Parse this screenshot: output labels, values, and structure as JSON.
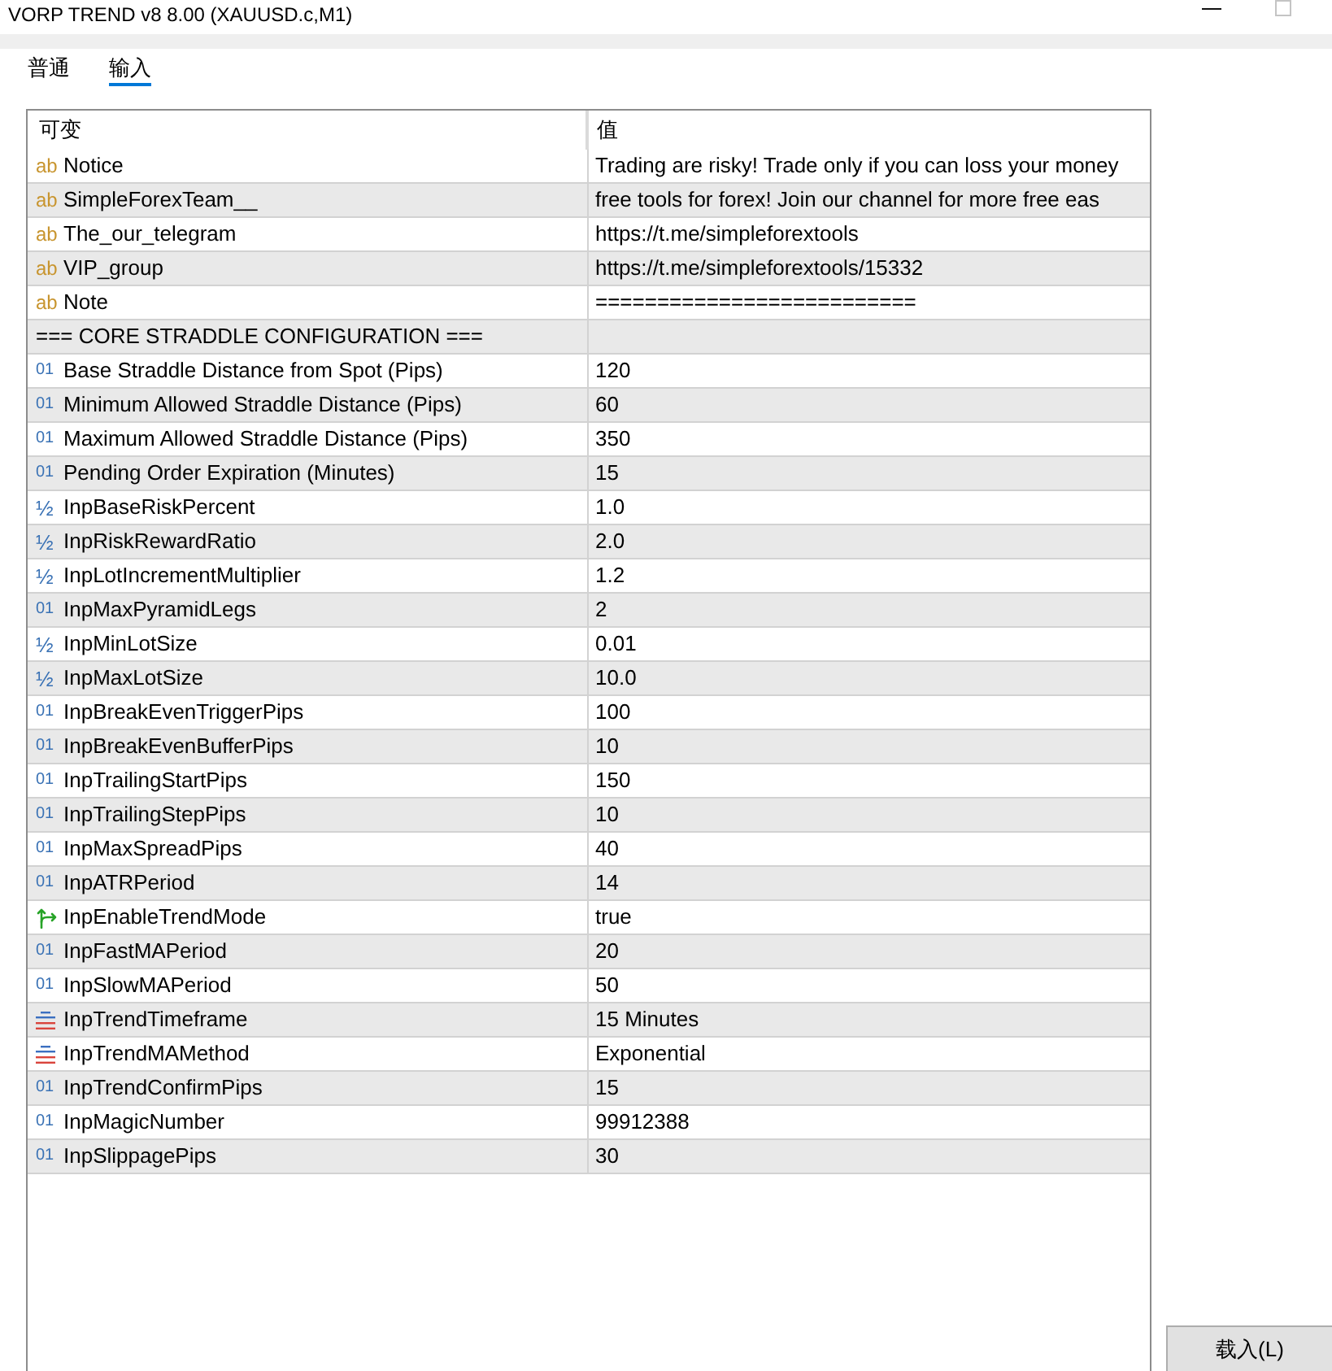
{
  "window": {
    "title": "VORP TREND v8 8.00 (XAUUSD.c,M1)"
  },
  "tabs": [
    {
      "label": "普通",
      "selected": false
    },
    {
      "label": "输入",
      "selected": true
    }
  ],
  "table": {
    "columns": [
      "可变",
      "值"
    ],
    "rows": [
      {
        "kind": "string",
        "type_icon": "ab",
        "name": "Notice",
        "value": "Trading are risky! Trade only if you can loss your money"
      },
      {
        "kind": "string",
        "type_icon": "ab",
        "name": "SimpleForexTeam__",
        "value": "free tools for forex! Join our channel for more free eas"
      },
      {
        "kind": "string",
        "type_icon": "ab",
        "name": "The_our_telegram",
        "value": "https://t.me/simpleforextools"
      },
      {
        "kind": "string",
        "type_icon": "ab",
        "name": "VIP_group",
        "value": "https://t.me/simpleforextools/15332"
      },
      {
        "kind": "string",
        "type_icon": "ab",
        "name": "Note",
        "value": "=========================="
      },
      {
        "kind": "group",
        "name": "=== CORE STRADDLE CONFIGURATION ==="
      },
      {
        "kind": "integer",
        "type_icon": "01",
        "name": "Base Straddle Distance from Spot (Pips)",
        "value": "120"
      },
      {
        "kind": "integer",
        "type_icon": "01",
        "name": "Minimum Allowed Straddle Distance (Pips)",
        "value": "60"
      },
      {
        "kind": "integer",
        "type_icon": "01",
        "name": "Maximum Allowed Straddle Distance (Pips)",
        "value": "350"
      },
      {
        "kind": "integer",
        "type_icon": "01",
        "name": "Pending Order Expiration (Minutes)",
        "value": "15"
      },
      {
        "kind": "double",
        "type_icon": "½",
        "name": "InpBaseRiskPercent",
        "value": "1.0"
      },
      {
        "kind": "double",
        "type_icon": "½",
        "name": "InpRiskRewardRatio",
        "value": "2.0"
      },
      {
        "kind": "double",
        "type_icon": "½",
        "name": "InpLotIncrementMultiplier",
        "value": "1.2"
      },
      {
        "kind": "integer",
        "type_icon": "01",
        "name": "InpMaxPyramidLegs",
        "value": "2"
      },
      {
        "kind": "double",
        "type_icon": "½",
        "name": "InpMinLotSize",
        "value": "0.01"
      },
      {
        "kind": "double",
        "type_icon": "½",
        "name": "InpMaxLotSize",
        "value": "10.0"
      },
      {
        "kind": "integer",
        "type_icon": "01",
        "name": "InpBreakEvenTriggerPips",
        "value": "100"
      },
      {
        "kind": "integer",
        "type_icon": "01",
        "name": "InpBreakEvenBufferPips",
        "value": "10"
      },
      {
        "kind": "integer",
        "type_icon": "01",
        "name": "InpTrailingStartPips",
        "value": "150"
      },
      {
        "kind": "integer",
        "type_icon": "01",
        "name": "InpTrailingStepPips",
        "value": "10"
      },
      {
        "kind": "integer",
        "type_icon": "01",
        "name": "InpMaxSpreadPips",
        "value": "40"
      },
      {
        "kind": "integer",
        "type_icon": "01",
        "name": "InpATRPeriod",
        "value": "14"
      },
      {
        "kind": "bool",
        "name": "InpEnableTrendMode",
        "value": "true"
      },
      {
        "kind": "integer",
        "type_icon": "01",
        "name": "InpFastMAPeriod",
        "value": "20"
      },
      {
        "kind": "integer",
        "type_icon": "01",
        "name": "InpSlowMAPeriod",
        "value": "50"
      },
      {
        "kind": "enum",
        "name": "InpTrendTimeframe",
        "value": "15 Minutes"
      },
      {
        "kind": "enum",
        "name": "InpTrendMAMethod",
        "value": "Exponential"
      },
      {
        "kind": "integer",
        "type_icon": "01",
        "name": "InpTrendConfirmPips",
        "value": "15"
      },
      {
        "kind": "integer",
        "type_icon": "01",
        "name": "InpMagicNumber",
        "value": "99912388"
      },
      {
        "kind": "integer",
        "type_icon": "01",
        "name": "InpSlippagePips",
        "value": "30"
      }
    ]
  },
  "buttons": [
    {
      "label": "载入(L)"
    }
  ]
}
